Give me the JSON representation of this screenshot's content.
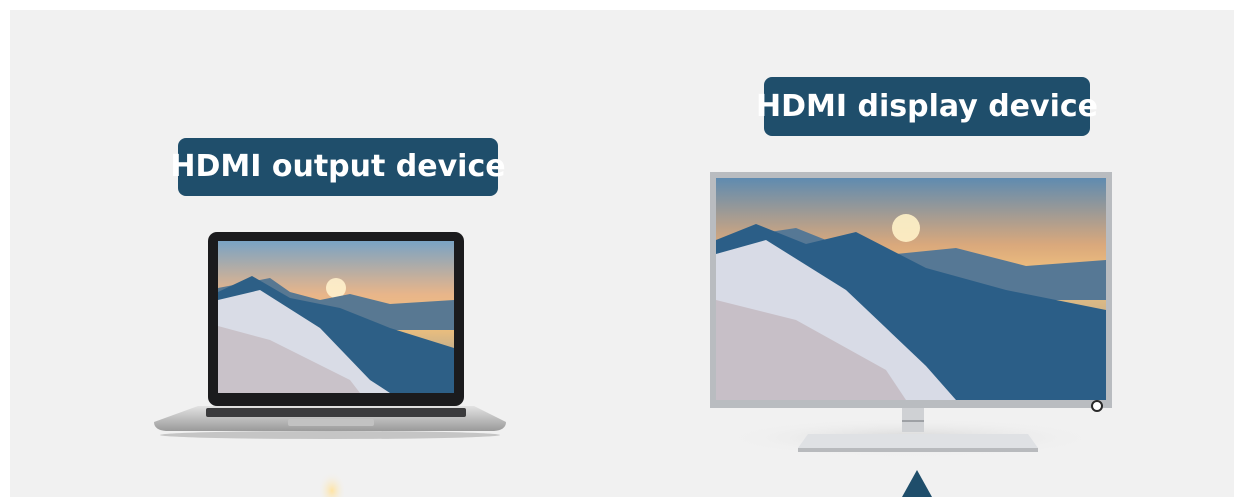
{
  "labels": {
    "output": "HDMI output device",
    "display": "HDMI display device"
  },
  "colors": {
    "background": "#f1f1f1",
    "label_bg": "#1f4e6b",
    "label_text": "#ffffff",
    "accent_arrow": "#1f4e6b"
  },
  "icons": {
    "laptop": "laptop-icon",
    "monitor": "monitor-icon",
    "arrow": "arrow-up-icon"
  }
}
